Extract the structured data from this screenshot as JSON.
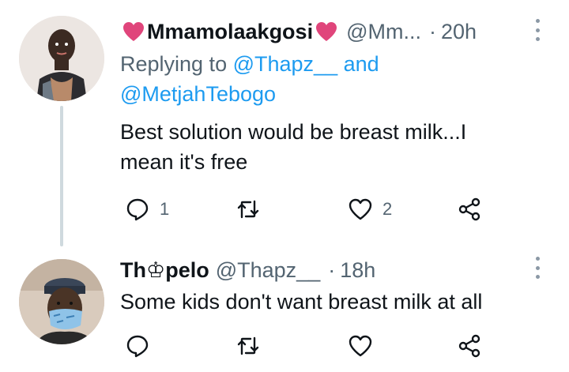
{
  "tweets": [
    {
      "display_name": "Mmamolaakgosi",
      "handle": "@Mm...",
      "separator": "·",
      "time": "20h",
      "replying_prefix": "Replying to",
      "replying_to": [
        "@Thapz__",
        "@MetjahTebogo"
      ],
      "replying_joiner": "and",
      "text_lines": [
        "Best solution would be breast milk...I",
        "mean it's free"
      ],
      "reply_count": "1",
      "retweet_count": "",
      "like_count": "2"
    },
    {
      "display_name_pre": "Th",
      "display_name_glyph": "♔",
      "display_name_post": "pelo",
      "handle": "@Thapz__",
      "separator": "·",
      "time": "18h",
      "text": "Some kids don't want breast milk at all",
      "reply_count": "",
      "retweet_count": "",
      "like_count": ""
    }
  ],
  "colors": {
    "heart_emoji": "#e0457b",
    "mention": "#1d9bf0",
    "muted": "#536471",
    "thread_line": "#cfd9de"
  },
  "icons": [
    "reply-icon",
    "retweet-icon",
    "like-icon",
    "share-icon",
    "more-icon",
    "heart-emoji-icon"
  ]
}
